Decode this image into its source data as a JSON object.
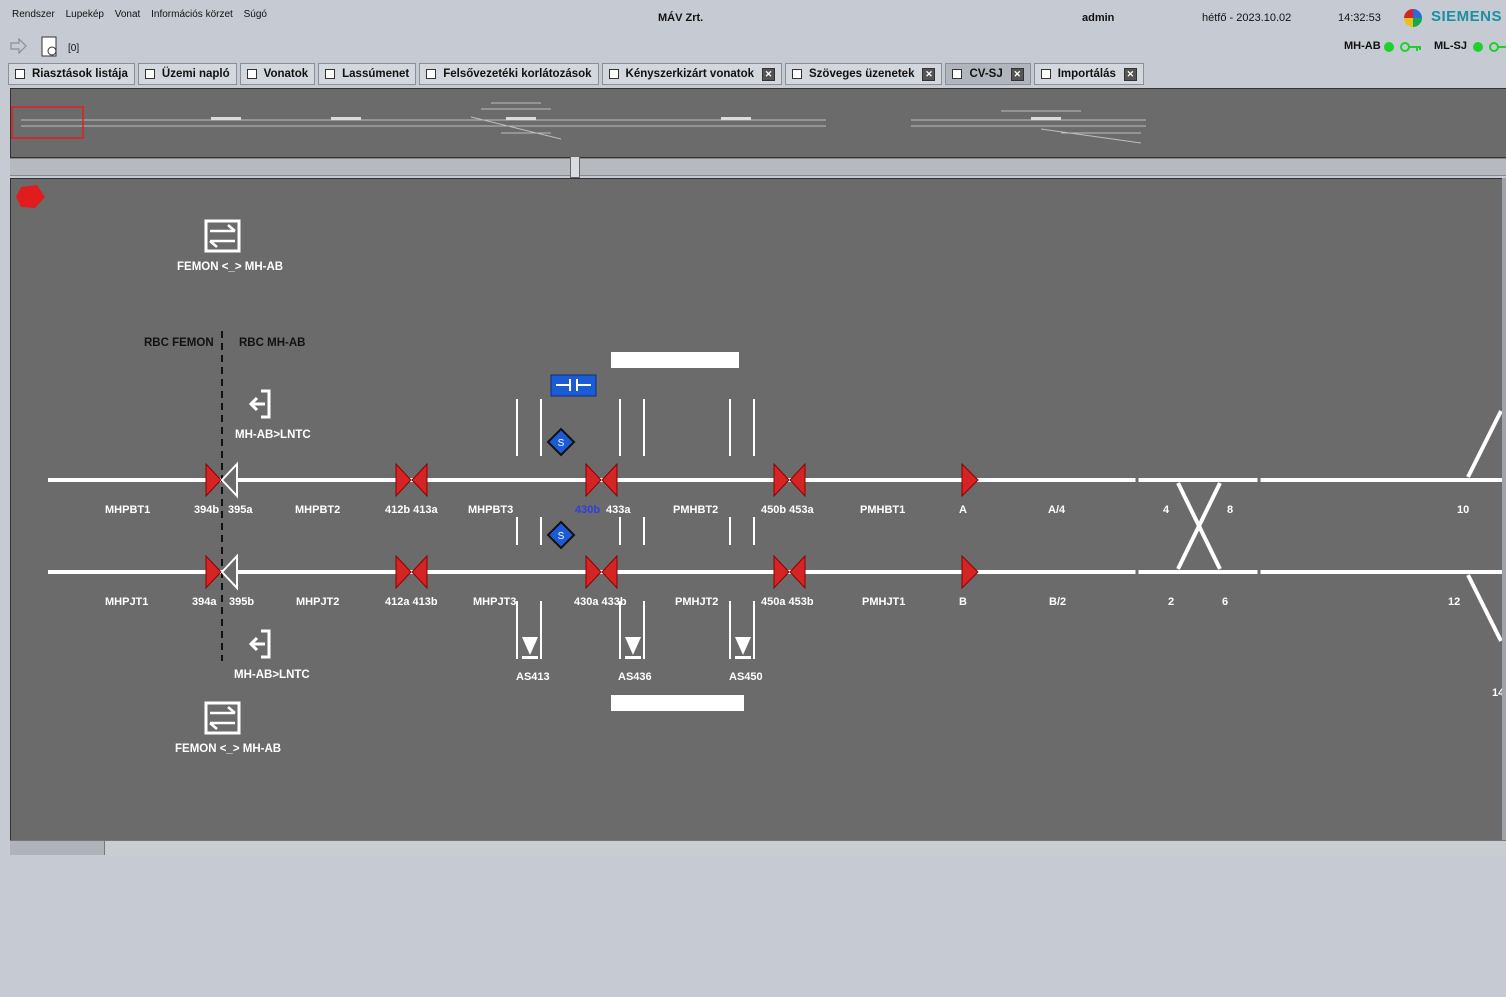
{
  "menu": [
    "Rendszer",
    "Lupekép",
    "Vonat",
    "Információs körzet",
    "Súgó"
  ],
  "header": {
    "company": "MÁV Zrt.",
    "user": "admin",
    "date": "hétfő - 2023.10.02",
    "time": "14:32:53",
    "brand": "SIEMENS",
    "counter": "[0]"
  },
  "status": [
    {
      "name": "MH-AB"
    },
    {
      "name": "ML-SJ"
    }
  ],
  "tabs": [
    {
      "label": "Riasztások listája",
      "closable": false
    },
    {
      "label": "Üzemi napló",
      "closable": false
    },
    {
      "label": "Vonatok",
      "closable": false
    },
    {
      "label": "Lassúmenet",
      "closable": false
    },
    {
      "label": "Felsővezetéki korlátozások",
      "closable": false
    },
    {
      "label": "Kényszerkizárt vonatok",
      "closable": true
    },
    {
      "label": "Szöveges üzenetek",
      "closable": true
    },
    {
      "label": "CV-SJ",
      "closable": true,
      "active": true
    },
    {
      "label": "Importálás",
      "closable": true
    }
  ],
  "diagram": {
    "femon_top": "FEMON <_> MH-AB",
    "femon_bottom": "FEMON <_> MH-AB",
    "rbc_left": "RBC FEMON",
    "rbc_right": "RBC MH-AB",
    "lntc_top": "MH-AB>LNTC",
    "lntc_bottom": "MH-AB>LNTC",
    "track1": [
      "MHPBT1",
      "394b",
      "395a",
      "MHPBT2",
      "412b 413a",
      "MHPBT3",
      "430b",
      "433a",
      "PMHBT2",
      "450b 453a",
      "PMHBT1",
      "A",
      "A/4",
      "4",
      "8",
      "10"
    ],
    "track2": [
      "MHPJT1",
      "394a",
      "395b",
      "MHPJT2",
      "412a 413b",
      "MHPJT3",
      "430a 433b",
      "PMHJT2",
      "450a 453b",
      "PMHJT1",
      "B",
      "B/2",
      "2",
      "6",
      "12"
    ],
    "as_labels": [
      "AS413",
      "AS436",
      "AS450"
    ],
    "edge_label": "14"
  },
  "colors": {
    "background": "#6b6b6b",
    "track": "#ffffff",
    "signal": "#d42424",
    "highlight": "#2255cc",
    "panel": "#c6cbd3"
  }
}
